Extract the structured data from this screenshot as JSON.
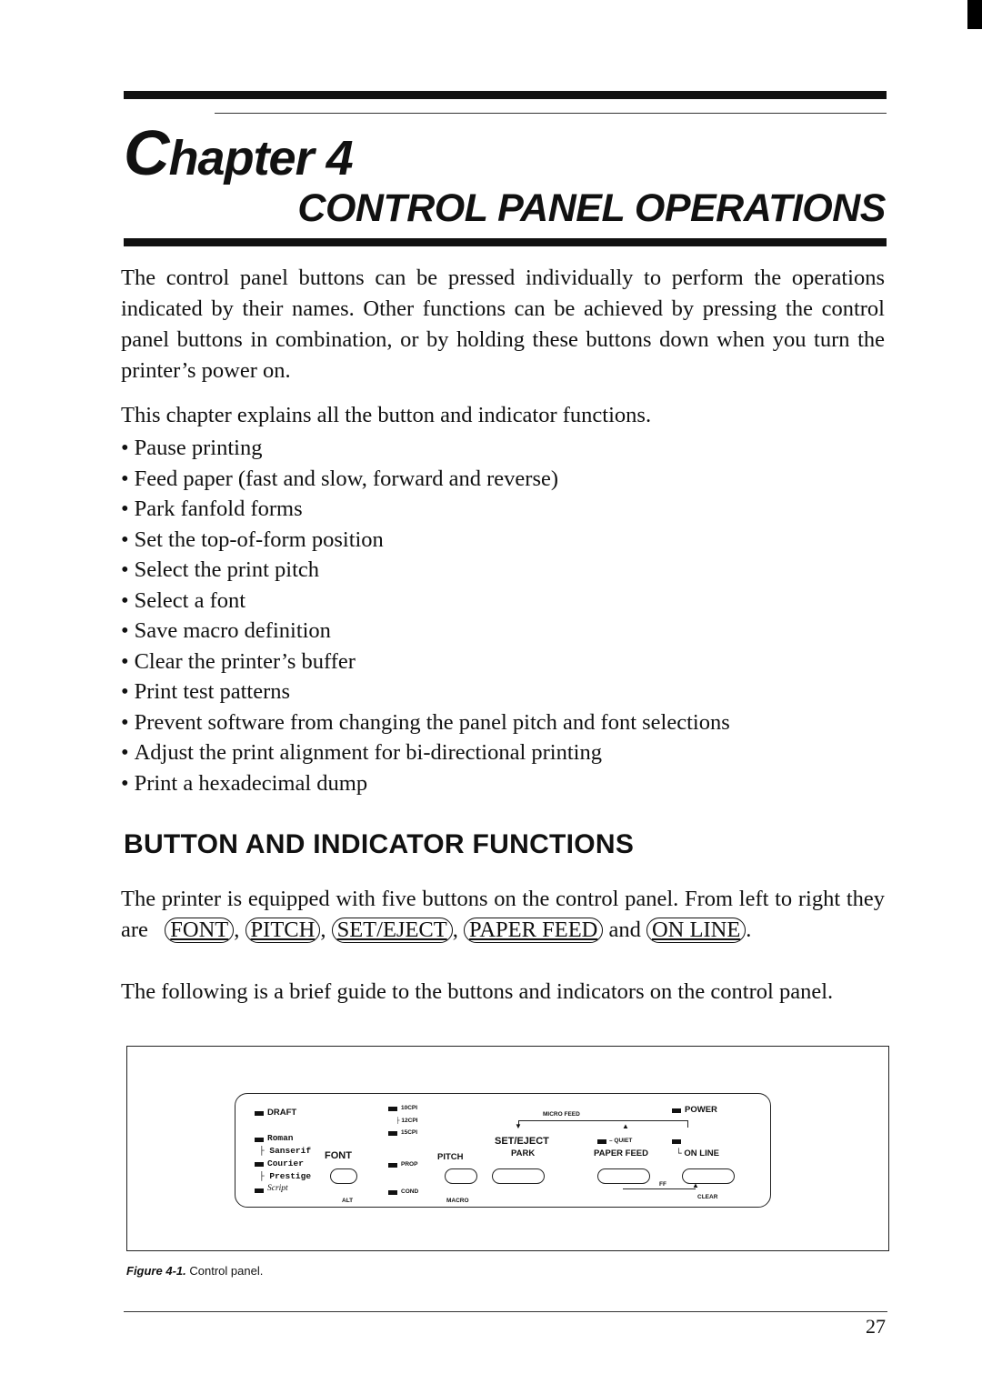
{
  "chapter": {
    "label_cap": "C",
    "label_rest": "hapter 4",
    "title": "CONTROL PANEL OPERATIONS"
  },
  "intro": {
    "paragraph": "The control panel buttons can be pressed individually to perform the operations indicated by their names. Other functions can be achieved by pressing the control panel buttons in combination, or by holding these buttons down when you turn the printer’s power on.",
    "list_intro": "This chapter explains all the button and indicator functions.",
    "bullets": [
      "Pause printing",
      "Feed paper (fast and slow, forward and reverse)",
      "Park fanfold forms",
      "Set the top-of-form position",
      "Select the print pitch",
      "Select a font",
      "Save macro definition",
      "Clear the printer’s buffer",
      "Print test patterns",
      "Prevent software from changing the panel pitch and font selections",
      "Adjust the print alignment for bi-directional printing",
      "Print a hexadecimal dump"
    ]
  },
  "section": {
    "heading": "BUTTON AND INDICATOR FUNCTIONS",
    "p1_start": "The printer is equipped with five buttons on the control panel. From left to right they are",
    "keys": [
      "FONT",
      "PITCH",
      "SET/EJECT",
      "PAPER FEED",
      "ON LINE"
    ],
    "and_word": "and",
    "p2": "The following is a brief guide to the buttons and indicators on the control panel."
  },
  "figure": {
    "panel": {
      "font_indicators": [
        "DRAFT",
        "Roman",
        "Sanserif",
        "Courier",
        "Prestige",
        "Script"
      ],
      "font_button": "FONT",
      "font_alt": "ALT",
      "pitch_indicators": [
        "10CPI",
        "12CPI",
        "15CPI",
        "PROP",
        "COND"
      ],
      "pitch_button": "PITCH",
      "pitch_alt": "MACRO",
      "micro_feed": "MICRO FEED",
      "set_eject_line1": "SET/EJECT",
      "set_eject_line2": "PARK",
      "quiet": "QUIET",
      "paper_feed": "PAPER FEED",
      "power": "POWER",
      "on_line": "ON LINE",
      "ff": "FF",
      "clear": "CLEAR"
    },
    "caption_label": "Figure 4-1.",
    "caption_text": "Control panel."
  },
  "page_number": "27"
}
